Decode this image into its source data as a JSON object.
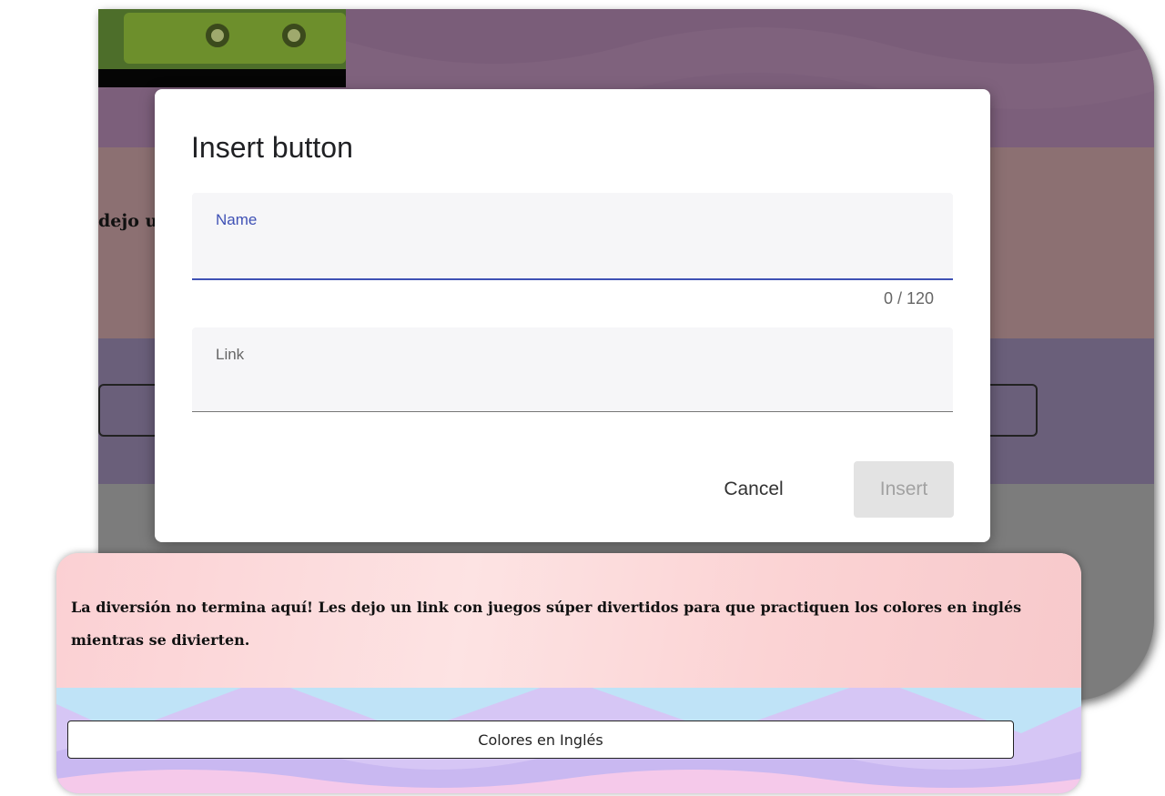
{
  "dialog": {
    "title": "Insert button",
    "name_field": {
      "label": "Name",
      "value": "",
      "counter": "0 / 120"
    },
    "link_field": {
      "label": "Link",
      "value": ""
    },
    "cancel_label": "Cancel",
    "insert_label": "Insert"
  },
  "background_form": {
    "partial_text": "dejo u"
  },
  "card": {
    "description": "La diversión no termina aquí! Les dejo un link con juegos súper divertidos para que practiquen los colores en inglés mientras se divierten.",
    "button_label": "Colores en Inglés"
  },
  "colors": {
    "accent": "#3f51b5",
    "insert_disabled_bg": "#e3e3e3",
    "card_pink": "#fbd7d8",
    "card_wave_blue": "#bfe3f7",
    "card_wave_purple": "#d6c6f5"
  },
  "icons": [
    "wheel-graphic"
  ]
}
